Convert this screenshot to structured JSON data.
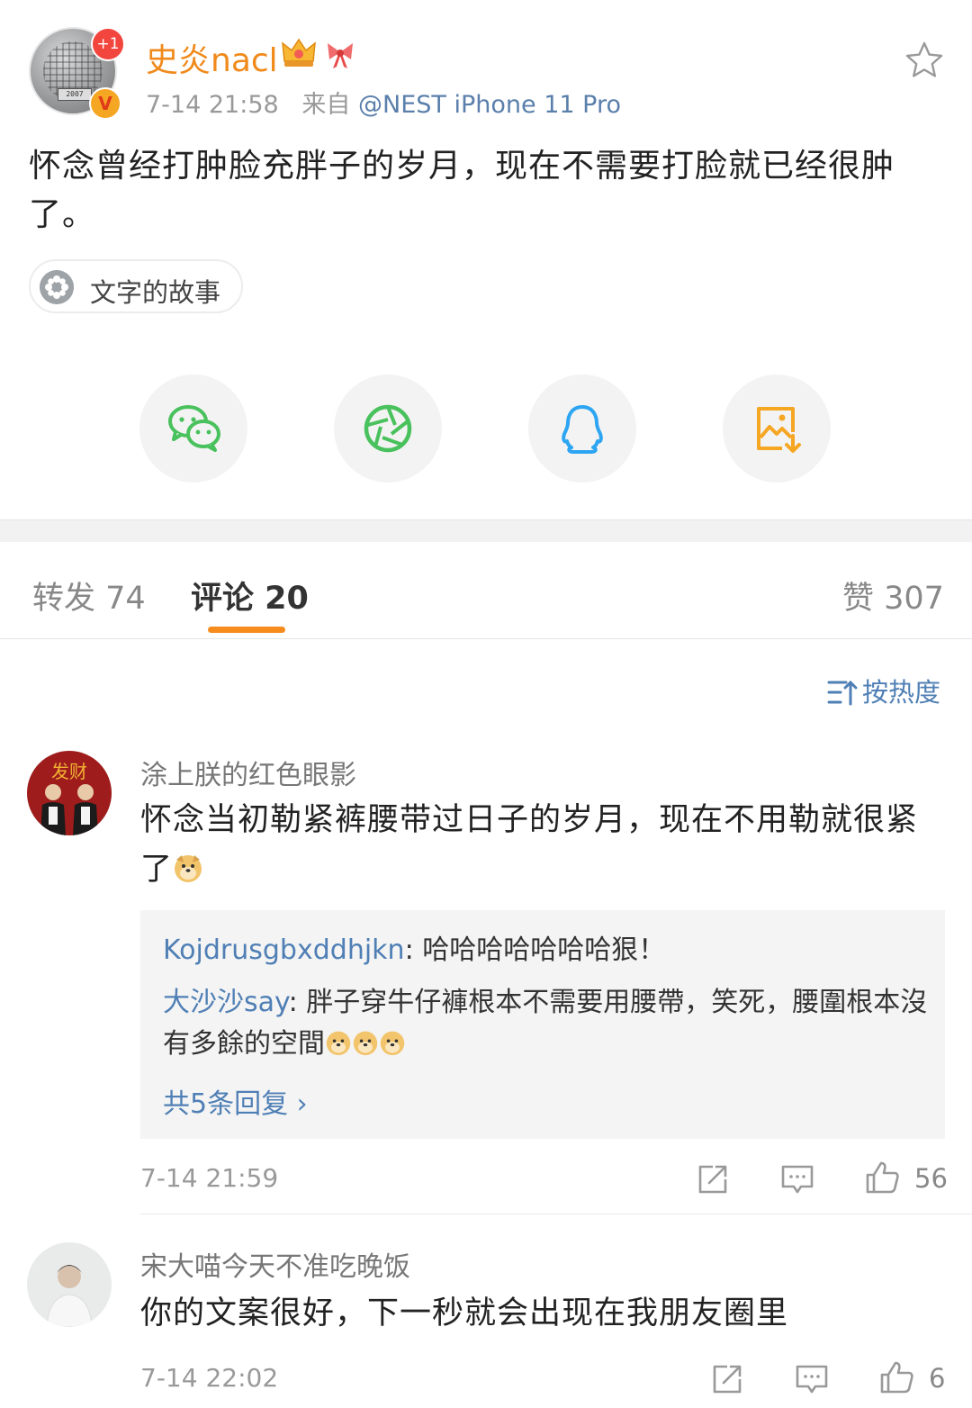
{
  "post": {
    "username": "史炎nacl",
    "avatar_badge": "+1",
    "verified_badge": "V",
    "avatar_plate": "2007",
    "time": "7-14 21:58",
    "source_prefix": "来自",
    "source": "@NEST iPhone 11 Pro",
    "text": "怀念曾经打肿脸充胖子的岁月，现在不需要打脸就已经很肿了。",
    "topic": "文字的故事",
    "share_icons": [
      "wechat-icon",
      "moments-icon",
      "qq-icon",
      "save-image-icon"
    ]
  },
  "tabs": {
    "repost_label": "转发 74",
    "comment_label": "评论 20",
    "like_label": "赞 307"
  },
  "sort": {
    "label": "按热度"
  },
  "comments": [
    {
      "name": "涂上朕的红色眼影",
      "avatar_text": "发财",
      "text": "怀念当初勒紧裤腰带过日子的岁月，现在不用勒就很紧了",
      "replies": [
        {
          "who": "Kojdrusgbxddhjkn",
          "text": ": 哈哈哈哈哈哈哈狠！"
        },
        {
          "who": "大沙沙say",
          "text": ": 胖子穿牛仔褲根本不需要用腰帶，笑死，腰圍根本沒有多餘的空間"
        }
      ],
      "more_replies": "共5条回复 ›",
      "time": "7-14 21:59",
      "likes": "56"
    },
    {
      "name": "宋大喵今天不准吃晚饭",
      "text": "你的文案很好，下一秒就会出现在我朋友圈里",
      "time": "7-14 22:02",
      "likes": "6"
    }
  ],
  "colors": {
    "username": "#f08a1c",
    "link_blue": "#4f7fb5",
    "tab_indicator": "#f78c1e",
    "wechat_green": "#49c15c",
    "qq_blue": "#2da5f2",
    "save_orange": "#f5a623"
  }
}
